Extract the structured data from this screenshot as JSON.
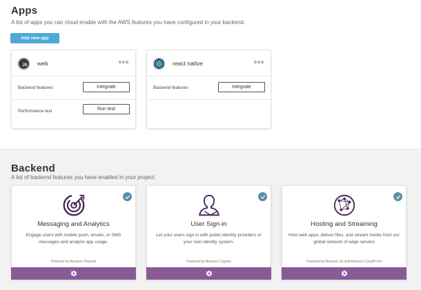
{
  "apps": {
    "title": "Apps",
    "subtitle": "A list of apps you can cloud enable with the AWS features you have configured in your backend.",
    "add_button": "Add new app",
    "cards": [
      {
        "name": "web",
        "logo_text": "JS",
        "rows": [
          {
            "label": "Backend features",
            "button": "Integrate"
          },
          {
            "label": "Performance test",
            "button": "Run test"
          }
        ]
      },
      {
        "name": "react native",
        "rows": [
          {
            "label": "Backend features",
            "button": "Integrate"
          }
        ]
      }
    ]
  },
  "backend": {
    "title": "Backend",
    "subtitle": "A list of backend features you have enabled in your project.",
    "cards": [
      {
        "title": "Messaging and Analytics",
        "description": "Engage users with mobile push, emails, or SMS messages and analyze app usage.",
        "powered": "Powered by Amazon Pinpoint",
        "icon": "target-icon"
      },
      {
        "title": "User Sign-in",
        "description": "Let your users sign in with public identity providers or your own identity system.",
        "powered": "Powered by Amazon Cognito",
        "icon": "user-silhouette-icon"
      },
      {
        "title": "Hosting and Streaming",
        "description": "Host web apps, deliver files, and stream media from our global network of edge servers",
        "powered": "Powered by Amazon S3 and Amazon CloudFront",
        "icon": "globe-network-icon"
      }
    ]
  },
  "colors": {
    "primary_button": "#4ea9d8",
    "feature_footer": "#8a5a96",
    "icon_purple": "#4a2a5a",
    "check_badge": "#5b8fa8"
  }
}
